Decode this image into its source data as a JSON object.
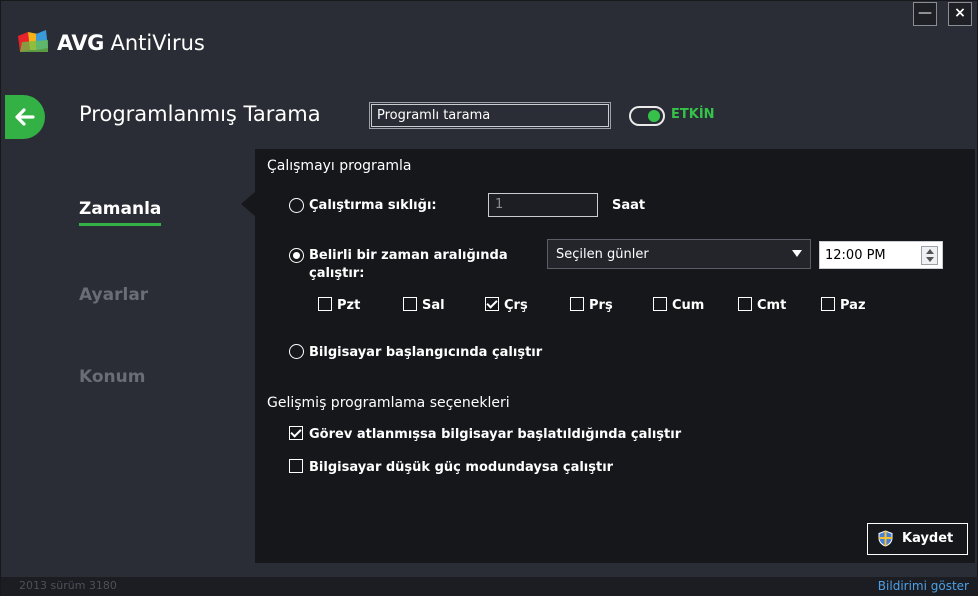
{
  "app": {
    "brand_bold": "AVG",
    "brand_rest": " AntiVirus",
    "minimize_glyph": "—",
    "close_glyph": "×"
  },
  "header": {
    "title": "Programlanmış Tarama",
    "name_value": "Programlı tarama",
    "toggle_label": "ETKİN"
  },
  "sidebar": {
    "items": [
      {
        "label": "Zamanla",
        "active": true
      },
      {
        "label": "Ayarlar",
        "active": false
      },
      {
        "label": "Konum",
        "active": false
      }
    ]
  },
  "schedule": {
    "section_title": "Çalışmayı programla",
    "freq_label": "Çalıştırma sıklığı:",
    "freq_value": "1",
    "freq_unit": "Saat",
    "interval_label_line1": "Belirli bir zaman aralığında",
    "interval_label_line2": "çalıştır:",
    "interval_select_value": "Seçilen günler",
    "time_value": "12:00 PM",
    "days": [
      {
        "label": "Pzt",
        "checked": false
      },
      {
        "label": "Sal",
        "checked": false
      },
      {
        "label": "Çrş",
        "checked": true
      },
      {
        "label": "Prş",
        "checked": false
      },
      {
        "label": "Cum",
        "checked": false
      },
      {
        "label": "Cmt",
        "checked": false
      },
      {
        "label": "Paz",
        "checked": false
      }
    ],
    "startup_label": "Bilgisayar başlangıcında çalıştır"
  },
  "advanced": {
    "section_title": "Gelişmiş programlama seçenekleri",
    "missed_label": "Görev atlanmışsa bilgisayar başlatıldığında çalıştır",
    "missed_checked": true,
    "lowpower_label": "Bilgisayar düşük güç modundaysa çalıştır",
    "lowpower_checked": false
  },
  "actions": {
    "save_label": "Kaydet"
  },
  "status": {
    "version": "2013  sürüm 3180",
    "notification_link": "Bildirimi göster"
  },
  "colors": {
    "accent_green": "#33b145",
    "link_blue": "#4ea0e4",
    "panel_bg": "#15171b"
  }
}
